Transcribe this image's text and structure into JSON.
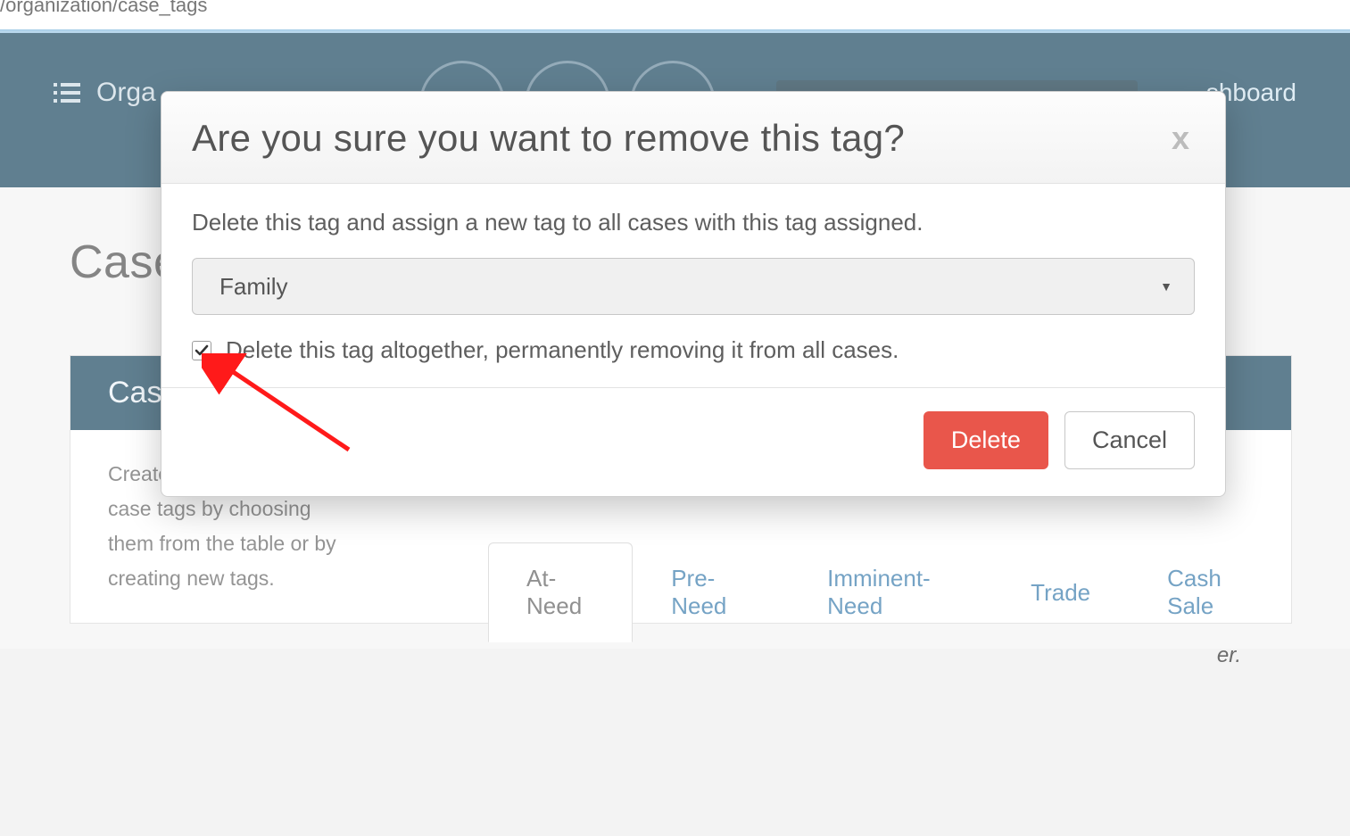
{
  "url_fragment": "/organization/case_tags",
  "nav": {
    "left_label": "Orga",
    "right_label": "shboard"
  },
  "page": {
    "title": "Case",
    "panel_title": "Cas",
    "description": "Create and manage your case tags by choosing them from the table or by creating new tags.",
    "filter_note_suffix": "er."
  },
  "tags": [
    {
      "label": "At-Need",
      "active": true
    },
    {
      "label": "Pre-Need",
      "active": false
    },
    {
      "label": "Imminent-Need",
      "active": false
    },
    {
      "label": "Trade",
      "active": false
    },
    {
      "label": "Cash Sale",
      "active": false
    }
  ],
  "modal": {
    "title": "Are you sure you want to remove this tag?",
    "close_glyph": "x",
    "instruction": "Delete this tag and assign a new tag to all cases with this tag assigned.",
    "select_value": "Family",
    "checkbox_label": "Delete this tag altogether, permanently removing it from all cases.",
    "checkbox_checked": true,
    "delete_label": "Delete",
    "cancel_label": "Cancel"
  }
}
